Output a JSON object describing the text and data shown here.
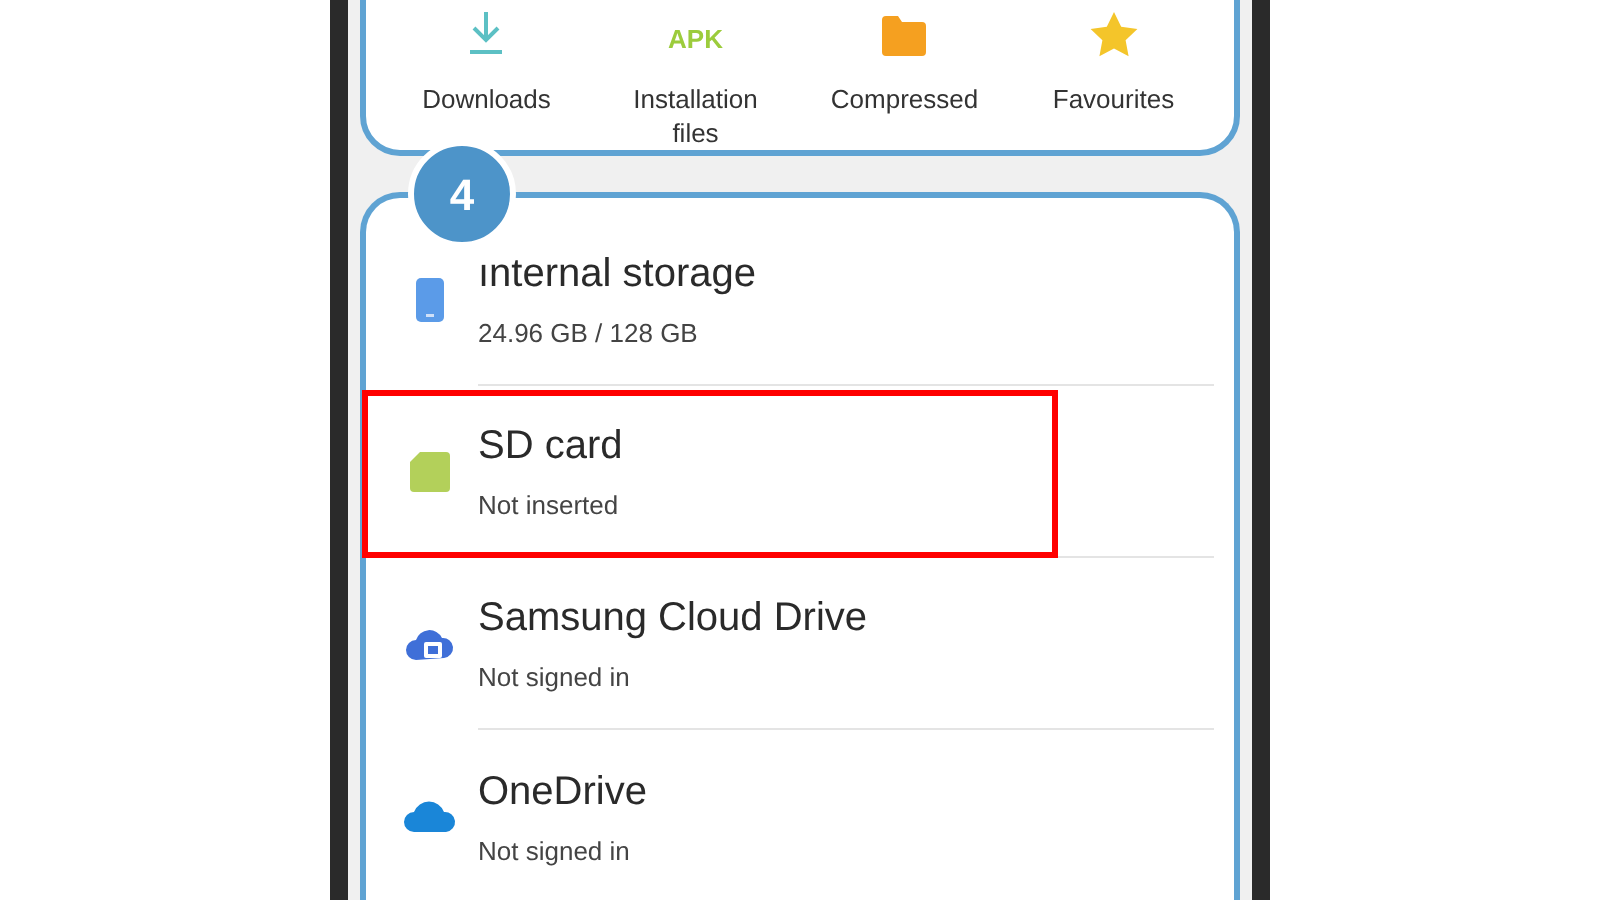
{
  "categories": [
    {
      "kind": "download",
      "label": "Downloads"
    },
    {
      "kind": "apk",
      "icon_text": "APK",
      "label": "Installation files"
    },
    {
      "kind": "folder",
      "label": "Compressed"
    },
    {
      "kind": "star",
      "label": "Favourites"
    }
  ],
  "step_badge": "4",
  "storage": [
    {
      "kind": "phone",
      "title": "ınternal storage",
      "subtitle": "24.96 GB / 128 GB",
      "highlighted": false
    },
    {
      "kind": "sdcard",
      "title": "SD card",
      "subtitle": "Not inserted",
      "highlighted": true
    },
    {
      "kind": "cloudlock",
      "title": "Samsung Cloud Drive",
      "subtitle": "Not signed in",
      "highlighted": false
    },
    {
      "kind": "cloud",
      "title": "OneDrive",
      "subtitle": "Not signed in",
      "highlighted": false
    }
  ]
}
